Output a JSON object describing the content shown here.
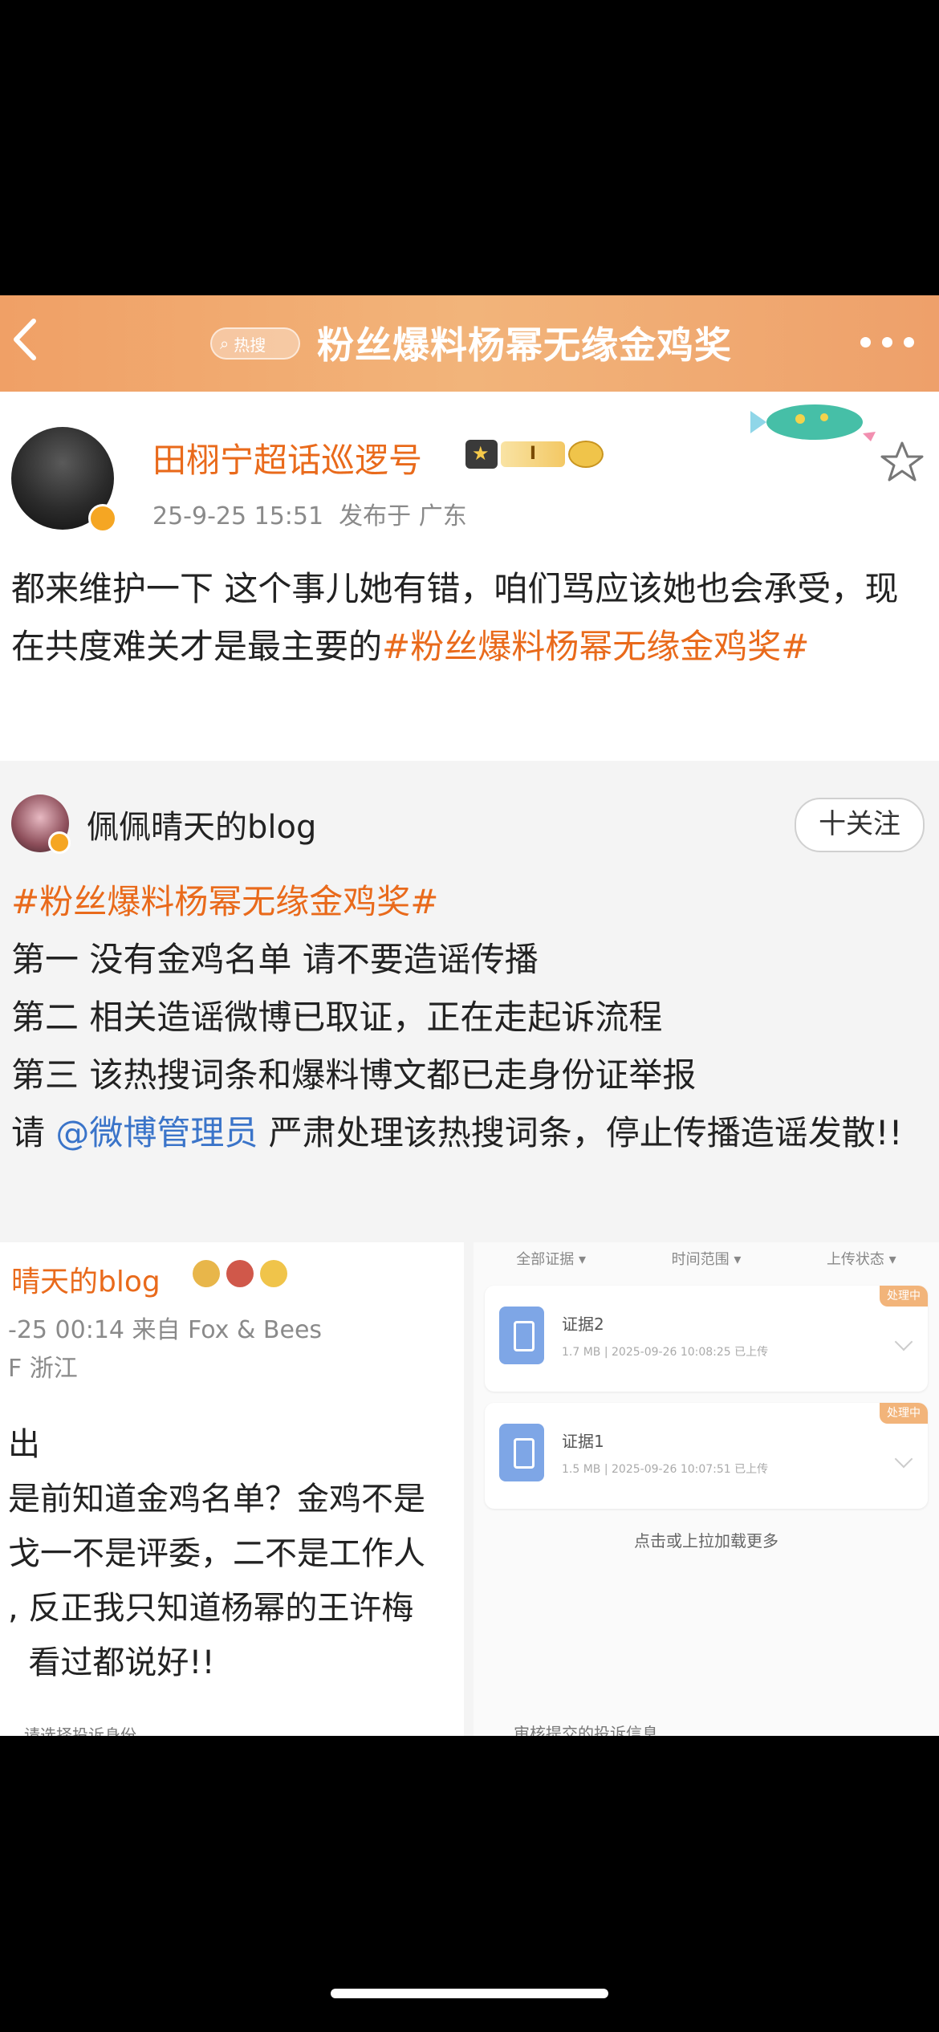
{
  "header": {
    "hot_label": "热搜",
    "title": "粉丝爆料杨幂无缘金鸡奖"
  },
  "post1": {
    "username": "田栩宁超话巡逻号",
    "level": "I",
    "time": "25-9-25 15:51",
    "location": "发布于 广东",
    "text_plain": "都来维护一下 这个事儿她有错，咱们骂应该她也会承受，现在共度难关才是最主要的",
    "hashtag": "#粉丝爆料杨幂无缘金鸡奖#"
  },
  "repost": {
    "username": "佩佩晴天的blog",
    "follow_label": "十关注",
    "hashtag": "#粉丝爆料杨幂无缘金鸡奖#",
    "line1": "第一 没有金鸡名单 请不要造谣传播",
    "line2": "第二 相关造谣微博已取证，正在走起诉流程",
    "line3": "第三 该热搜词条和爆料博文都已走身份证举报",
    "line4_pre": "请 ",
    "mention": "@微博管理员",
    "line4_post": " 严肃处理该热搜词条，停止传播造谣发散!!"
  },
  "embedded_left": {
    "username": "晴天的blog",
    "meta1": "-25 00:14  来自 Fox & Bees",
    "meta2": "F 浙江",
    "body": "出\n是前知道金鸡名单？金鸡不是\n戈一不是评委，二不是工作人\n, 反正我只知道杨幂的王许梅\n  看过都说好!!",
    "footer": "请选择投诉身份"
  },
  "embedded_right": {
    "filters": [
      "全部证据 ▾",
      "时间范围 ▾",
      "上传状态 ▾"
    ],
    "cards": [
      {
        "title": "证据2",
        "sub": "1.7 MB | 2025-09-26 10:08:25   已上传",
        "badge": "处理中"
      },
      {
        "title": "证据1",
        "sub": "1.5 MB | 2025-09-26 10:07:51   已上传",
        "badge": "处理中"
      }
    ],
    "load_more": "点击或上拉加载更多",
    "footer": "审核提交的投诉信息"
  },
  "colors": {
    "accent": "#e96a1b",
    "header_gradient_start": "#f0a066",
    "mention": "#3a74c9"
  }
}
